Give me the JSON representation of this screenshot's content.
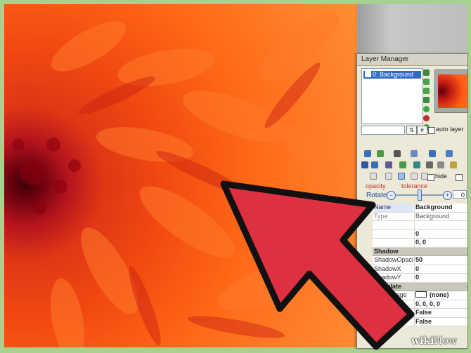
{
  "window": {
    "title": "Layer Manager"
  },
  "layers": [
    {
      "label": "0: Background",
      "checked": true
    }
  ],
  "toolbar_icons": [
    "arrow-up-icon",
    "arrow-down-icon",
    "move-up-icon",
    "move-down-icon",
    "add-layer-icon",
    "delete-layer-icon",
    "accept-icon"
  ],
  "name_input": {
    "value": ""
  },
  "buttons": {
    "swap": "⇅",
    "link": "#"
  },
  "auto_layer": {
    "label": "auto layer"
  },
  "hide": {
    "label": "hide"
  },
  "labels": {
    "opacity": "opacity",
    "tolerance": "tolerance"
  },
  "rotate": {
    "label": "Rotate",
    "minus": "−",
    "plus": "+",
    "value": "0"
  },
  "properties": {
    "name": {
      "key": "Name",
      "value": "Background"
    },
    "type": {
      "key": "Type",
      "value": "Background"
    },
    "row3": {
      "key": "",
      "value": ""
    },
    "row4": {
      "key": "",
      "value": "0"
    },
    "row5": {
      "key": "",
      "value": "0, 0"
    },
    "cat_shadow": "Shadow",
    "shadow_opacity": {
      "key": "ShadowOpacity",
      "value": "50"
    },
    "shadow_x": {
      "key": "ShadowX",
      "value": "0"
    },
    "shadow_y": {
      "key": "ShadowY",
      "value": "0"
    },
    "cat_template": "Template",
    "mask_image": {
      "key": "MaskImage",
      "value": "(none)"
    },
    "rectangle": {
      "key": "Rectangle",
      "value": "0, 0, 0, 0"
    },
    "row_false1": {
      "key": "",
      "value": "False"
    },
    "row_false2": {
      "key": "",
      "value": "False"
    }
  },
  "watermark": {
    "bold": "wiki",
    "regular": "How"
  },
  "colors": {
    "arrow_fill": "#de3040",
    "arrow_stroke": "#111111",
    "border": "#a9d18e"
  }
}
